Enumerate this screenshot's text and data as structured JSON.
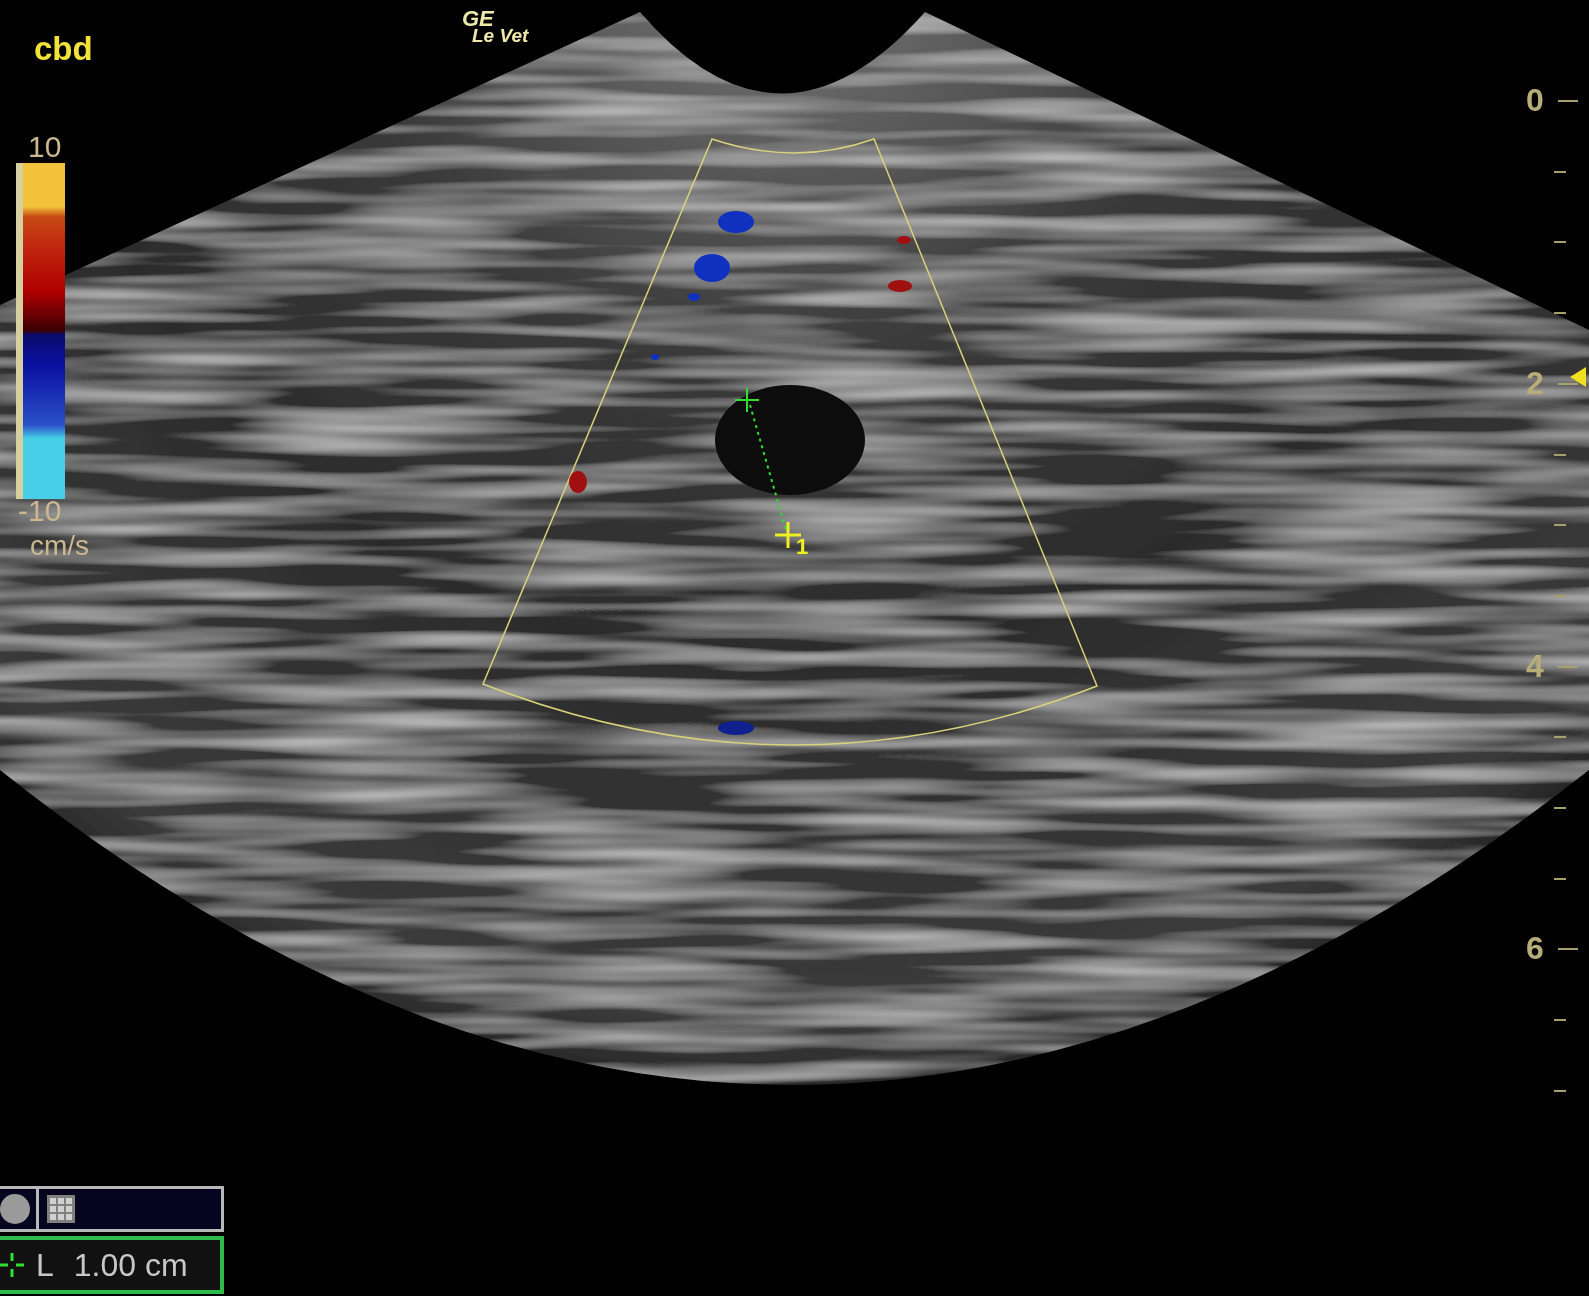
{
  "header": {
    "title": "cbd",
    "logo": {
      "brand": "GE",
      "model": "Le Vet"
    }
  },
  "color_scale": {
    "max": "10",
    "min": "-10",
    "unit": "cm/s"
  },
  "depth_scale": {
    "labels": [
      "0",
      "2",
      "4",
      "6"
    ]
  },
  "caliper": {
    "label": "1"
  },
  "measurement": {
    "name": "L",
    "value": "1.00 cm"
  }
}
